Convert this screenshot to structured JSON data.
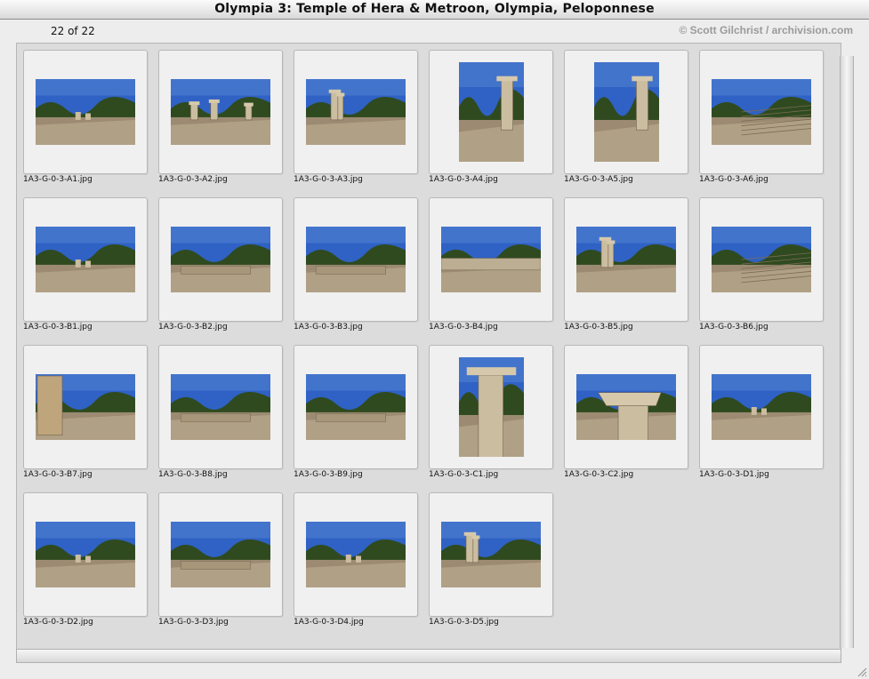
{
  "window": {
    "title": "Olympia 3: Temple of Hera & Metroon, Olympia, Peloponnese",
    "count_label": "22 of 22",
    "credit": "© Scott Gilchrist / archivision.com"
  },
  "thumbnails": [
    {
      "filename": "1A3-G-0-3-A1.jpg",
      "orientation": "landscape",
      "scene": "ruins-wide"
    },
    {
      "filename": "1A3-G-0-3-A2.jpg",
      "orientation": "landscape",
      "scene": "columns"
    },
    {
      "filename": "1A3-G-0-3-A3.jpg",
      "orientation": "landscape",
      "scene": "path-columns"
    },
    {
      "filename": "1A3-G-0-3-A4.jpg",
      "orientation": "portrait",
      "scene": "single-column"
    },
    {
      "filename": "1A3-G-0-3-A5.jpg",
      "orientation": "portrait",
      "scene": "column-blocks"
    },
    {
      "filename": "1A3-G-0-3-A6.jpg",
      "orientation": "landscape",
      "scene": "steps"
    },
    {
      "filename": "1A3-G-0-3-B1.jpg",
      "orientation": "landscape",
      "scene": "ruins-wide"
    },
    {
      "filename": "1A3-G-0-3-B2.jpg",
      "orientation": "landscape",
      "scene": "foundation"
    },
    {
      "filename": "1A3-G-0-3-B3.jpg",
      "orientation": "landscape",
      "scene": "foundation"
    },
    {
      "filename": "1A3-G-0-3-B4.jpg",
      "orientation": "landscape",
      "scene": "wall-blocks"
    },
    {
      "filename": "1A3-G-0-3-B5.jpg",
      "orientation": "landscape",
      "scene": "path-columns"
    },
    {
      "filename": "1A3-G-0-3-B6.jpg",
      "orientation": "landscape",
      "scene": "steps"
    },
    {
      "filename": "1A3-G-0-3-B7.jpg",
      "orientation": "landscape",
      "scene": "near-column"
    },
    {
      "filename": "1A3-G-0-3-B8.jpg",
      "orientation": "landscape",
      "scene": "foundation"
    },
    {
      "filename": "1A3-G-0-3-B9.jpg",
      "orientation": "landscape",
      "scene": "foundation"
    },
    {
      "filename": "1A3-G-0-3-C1.jpg",
      "orientation": "portrait",
      "scene": "capital-closeup"
    },
    {
      "filename": "1A3-G-0-3-C2.jpg",
      "orientation": "landscape",
      "scene": "capital-sky"
    },
    {
      "filename": "1A3-G-0-3-D1.jpg",
      "orientation": "landscape",
      "scene": "open-field"
    },
    {
      "filename": "1A3-G-0-3-D2.jpg",
      "orientation": "landscape",
      "scene": "open-field"
    },
    {
      "filename": "1A3-G-0-3-D3.jpg",
      "orientation": "landscape",
      "scene": "foundation"
    },
    {
      "filename": "1A3-G-0-3-D4.jpg",
      "orientation": "landscape",
      "scene": "ruins-wide"
    },
    {
      "filename": "1A3-G-0-3-D5.jpg",
      "orientation": "landscape",
      "scene": "path-columns"
    }
  ],
  "colors": {
    "sky": "#2f62c4",
    "sky_light": "#6b98de",
    "trees": "#2f4a1f",
    "stone": "#b9a98d",
    "ground": "#9c8b72"
  }
}
